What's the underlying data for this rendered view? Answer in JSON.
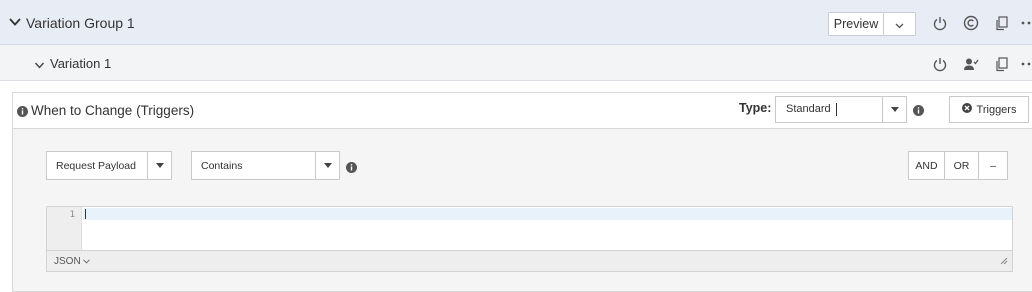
{
  "variation_group": {
    "title": "Variation Group 1",
    "preview_label": "Preview"
  },
  "variation": {
    "title": "Variation 1"
  },
  "triggers": {
    "heading": "When to Change (Triggers)",
    "type_label": "Type:",
    "type_value": "Standard",
    "triggers_button": "Triggers",
    "field_select": "Request Payload",
    "operator_select": "Contains",
    "and_label": "AND",
    "or_label": "OR",
    "remove_label": "–"
  },
  "editor": {
    "line_number": "1",
    "content": "",
    "language": "JSON"
  },
  "icons": {
    "group_chevron": "chevron-down-icon",
    "power": "power-icon",
    "copyright": "copyright-icon",
    "copy": "copy-icon",
    "more": "more-icon",
    "user_check": "user-check-icon",
    "info": "info-icon",
    "remove_circle": "remove-circle-icon"
  },
  "colors": {
    "group_header_bg": "#e8edf5",
    "variation_header_bg": "#f3f4f6",
    "panel_bg": "#f5f5f5",
    "active_line": "#e8f2fb"
  }
}
